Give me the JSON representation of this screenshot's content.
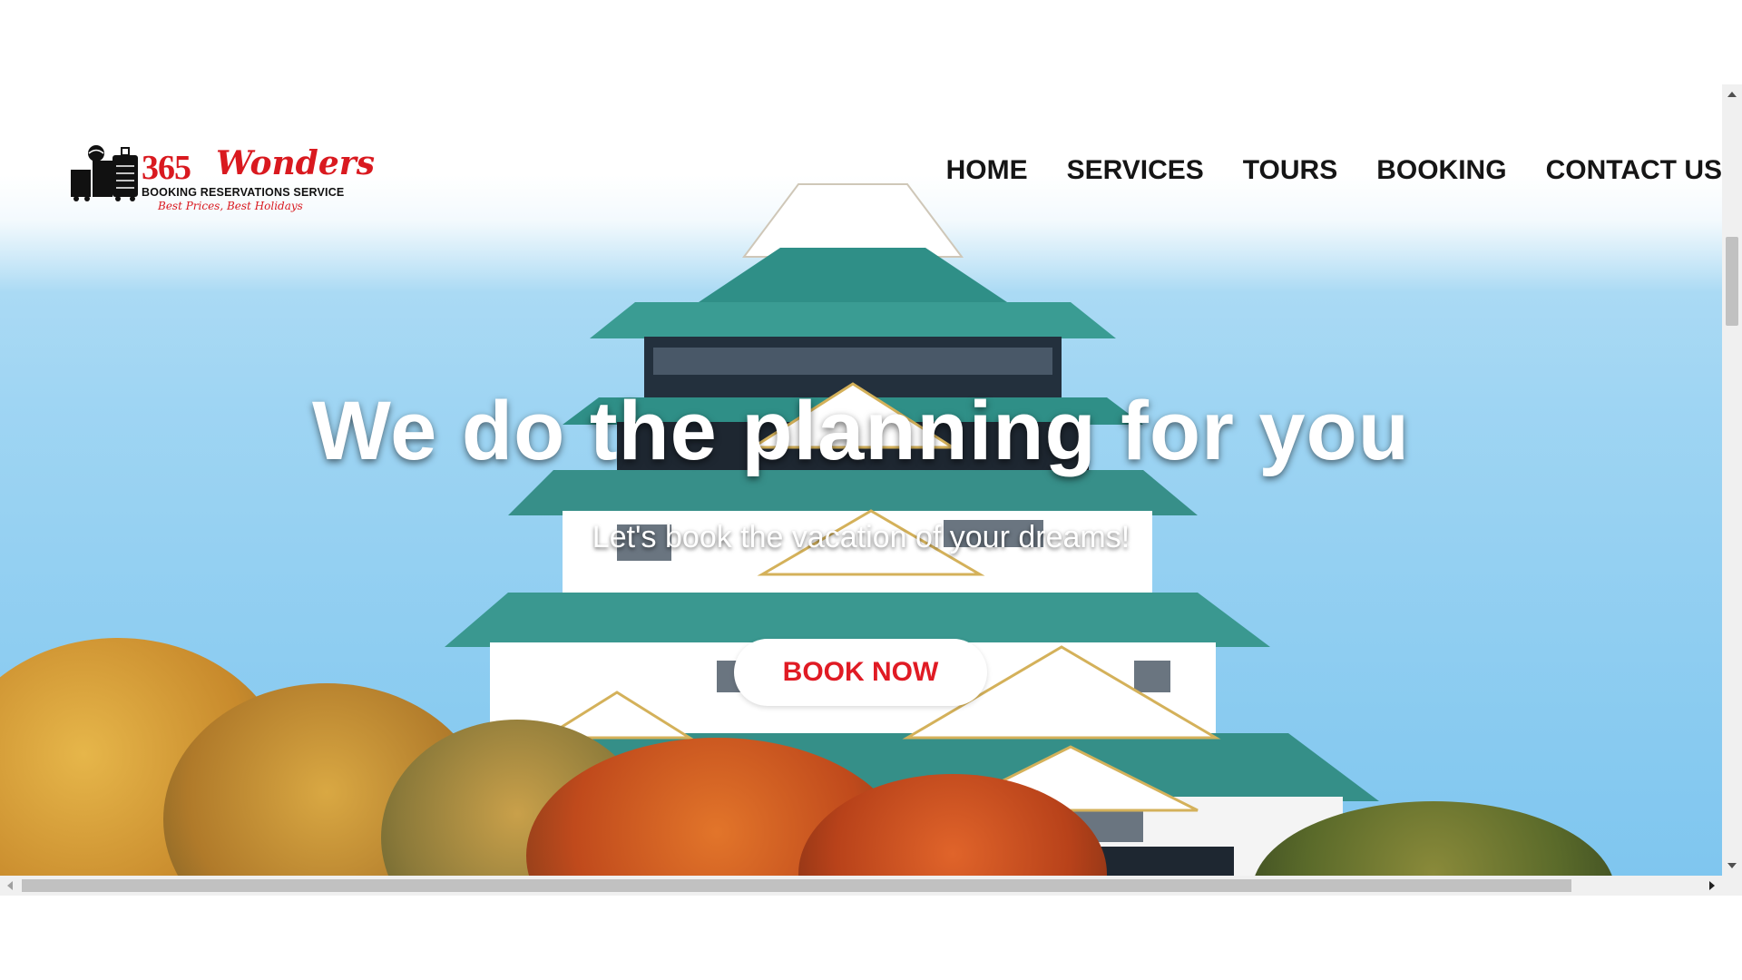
{
  "colors": {
    "accent": "#d9191f",
    "nav_text": "#151515",
    "button_text": "#e01b24",
    "button_bg": "#ffffff"
  },
  "logo": {
    "number": "365",
    "name": "Wonders",
    "subtitle": "BOOKING RESERVATIONS SERVICE",
    "tagline": "Best Prices, Best Holidays",
    "icon": "luggage-globe-icon"
  },
  "nav": {
    "items": [
      "HOME",
      "SERVICES",
      "TOURS",
      "BOOKING",
      "CONTACT US"
    ]
  },
  "hero": {
    "headline": "We do the planning for you",
    "subheadline": "Let's book the vacation of your dreams!",
    "cta_label": "BOOK NOW",
    "background": "japanese-castle-with-autumn-trees-photo"
  },
  "scrollbars": {
    "vertical_icons": [
      "scroll-up-icon",
      "scroll-down-icon"
    ],
    "horizontal_icons": [
      "scroll-left-icon",
      "scroll-right-icon"
    ]
  }
}
